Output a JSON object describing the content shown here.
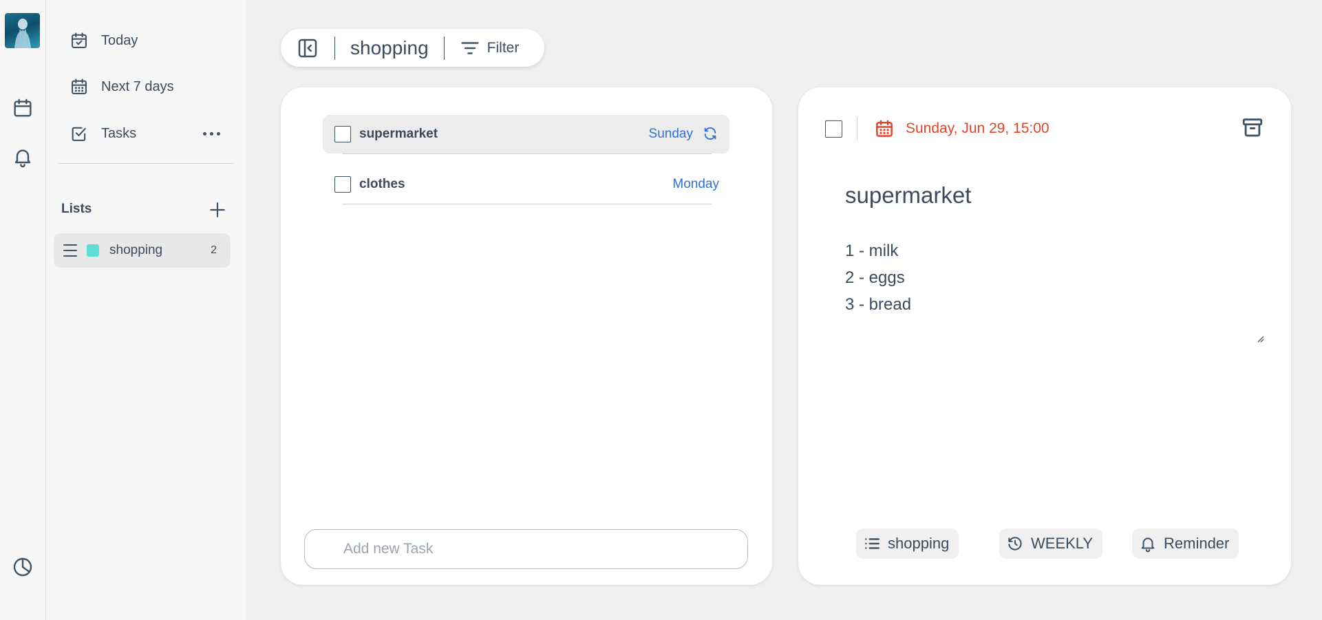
{
  "rail": {
    "avatar": "user-avatar",
    "icons": [
      "calendar-icon",
      "bell-icon",
      "stats-icon"
    ]
  },
  "sidebar": {
    "nav": [
      {
        "label": "Today",
        "icon": "calendar-check-icon"
      },
      {
        "label": "Next 7 days",
        "icon": "calendar-grid-icon"
      },
      {
        "label": "Tasks",
        "icon": "checkbox-icon"
      }
    ],
    "lists_title": "Lists",
    "lists": [
      {
        "name": "shopping",
        "count": "2",
        "color": "#5ddfd8"
      }
    ]
  },
  "toolbar": {
    "title": "shopping",
    "filter_label": "Filter"
  },
  "tasks": [
    {
      "name": "supermarket",
      "date": "Sunday",
      "repeat": true,
      "selected": true
    },
    {
      "name": "clothes",
      "date": "Monday",
      "repeat": false,
      "selected": false
    }
  ],
  "add_task": {
    "placeholder": "Add new Task"
  },
  "detail": {
    "date": "Sunday, Jun 29, 15:00",
    "title": "supermarket",
    "notes": [
      "1 - milk",
      "2 - eggs",
      "3 - bread"
    ],
    "chips": {
      "list": "shopping",
      "repeat": "WEEKLY",
      "reminder": "Reminder"
    }
  },
  "colors": {
    "accent_blue": "#2f6fd6",
    "due_red": "#e0452c",
    "list_swatch": "#5ddfd8"
  }
}
